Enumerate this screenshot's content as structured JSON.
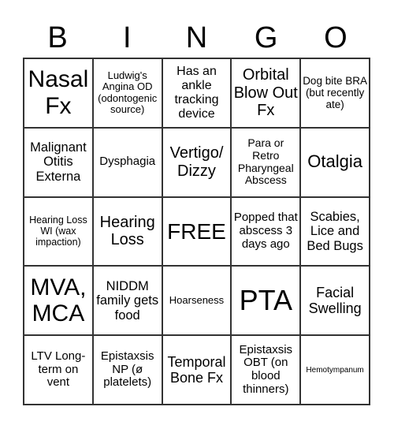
{
  "title_letters": [
    "B",
    "I",
    "N",
    "G",
    "O"
  ],
  "cells": [
    {
      "text": "Nasal Fx",
      "size": 30
    },
    {
      "text": "Ludwig's Angina OD (odontogenic source)",
      "size": 13
    },
    {
      "text": "Has an ankle tracking device",
      "size": 16
    },
    {
      "text": "Orbital Blow Out Fx",
      "size": 20
    },
    {
      "text": "Dog bite BRA (but recently ate)",
      "size": 13.5
    },
    {
      "text": "Malignant Otitis Externa",
      "size": 16.5
    },
    {
      "text": "Dysphagia",
      "size": 15
    },
    {
      "text": "Vertigo/ Dizzy",
      "size": 20
    },
    {
      "text": "Para or Retro Pharyngeal Abscess",
      "size": 14
    },
    {
      "text": "Otalgia",
      "size": 22
    },
    {
      "text": "Hearing Loss WI (wax impaction)",
      "size": 12.5
    },
    {
      "text": "Hearing Loss",
      "size": 20
    },
    {
      "text": "FREE",
      "size": 28
    },
    {
      "text": "Popped that abscess 3 days ago",
      "size": 15
    },
    {
      "text": "Scabies, Lice and Bed Bugs",
      "size": 16.5
    },
    {
      "text": "MVA, MCA",
      "size": 30
    },
    {
      "text": "NIDDM family gets food",
      "size": 16.5
    },
    {
      "text": "Hoarseness",
      "size": 13
    },
    {
      "text": "PTA",
      "size": 36
    },
    {
      "text": "Facial Swelling",
      "size": 18
    },
    {
      "text": "LTV Long-term on vent",
      "size": 15
    },
    {
      "text": "Epistaxsis NP (ø platelets)",
      "size": 15
    },
    {
      "text": "Temporal Bone Fx",
      "size": 18
    },
    {
      "text": "Epistaxsis OBT (on blood thinners)",
      "size": 15
    },
    {
      "text": "Hemotympanum",
      "size": 10
    }
  ]
}
